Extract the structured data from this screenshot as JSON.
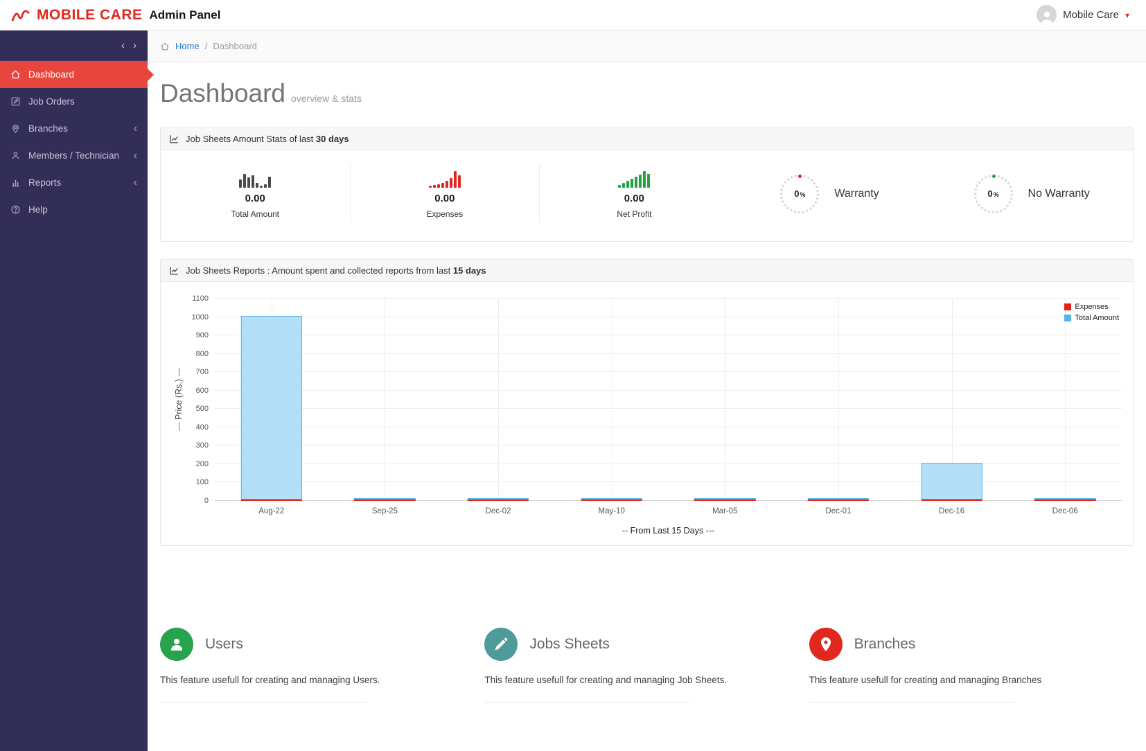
{
  "header": {
    "brand": "MOBILE CARE",
    "brand_suffix": "Admin Panel",
    "user_menu": {
      "name": "Mobile Care",
      "caret": "▾"
    }
  },
  "sidebar": {
    "collapse_left": "‹",
    "collapse_right": "›",
    "submenu_chevron": "‹",
    "items": [
      {
        "label": "Dashboard",
        "icon": "home-icon",
        "active": true,
        "has_submenu": false
      },
      {
        "label": "Job Orders",
        "icon": "edit-icon",
        "active": false,
        "has_submenu": false
      },
      {
        "label": "Branches",
        "icon": "pin-icon",
        "active": false,
        "has_submenu": true
      },
      {
        "label": "Members / Technician",
        "icon": "user-icon",
        "active": false,
        "has_submenu": true
      },
      {
        "label": "Reports",
        "icon": "bar-chart-icon",
        "active": false,
        "has_submenu": true
      },
      {
        "label": "Help",
        "icon": "help-icon",
        "active": false,
        "has_submenu": false
      }
    ]
  },
  "breadcrumb": {
    "home_label": "Home",
    "separator": "/",
    "current": "Dashboard"
  },
  "page_header": {
    "title": "Dashboard",
    "subtitle": "overview & stats"
  },
  "stats_panel": {
    "title_prefix": "Job Sheets Amount Stats of last ",
    "title_bold": "30 days",
    "stats": [
      {
        "value": "0.00",
        "label": "Total Amount",
        "spark_color": "#4a4a4a",
        "spark": [
          12,
          20,
          15,
          18,
          7,
          3,
          5,
          16
        ]
      },
      {
        "value": "0.00",
        "label": "Expenses",
        "spark_color": "#e0281f",
        "spark": [
          3,
          4,
          5,
          7,
          10,
          14,
          24,
          18
        ]
      },
      {
        "value": "0.00",
        "label": "Net Profit",
        "spark_color": "#27a243",
        "spark": [
          4,
          7,
          10,
          13,
          16,
          19,
          24,
          20
        ]
      }
    ],
    "knobs": [
      {
        "value": "0",
        "unit": "%",
        "label": "Warranty",
        "dot_color": "#e0281f"
      },
      {
        "value": "0",
        "unit": "%",
        "label": "No Warranty",
        "dot_color": "#27a243"
      }
    ]
  },
  "report_panel": {
    "title_prefix": "Job Sheets Reports : Amount spent and collected reports from last ",
    "title_bold": "15 days"
  },
  "chart_data": {
    "type": "bar",
    "categories": [
      "Aug-22",
      "Sep-25",
      "Dec-02",
      "May-10",
      "Mar-05",
      "Dec-01",
      "Dec-16",
      "Dec-06"
    ],
    "series": [
      {
        "name": "Expenses",
        "color": "#e8211d",
        "fill": "#e8211d",
        "values": [
          0,
          0,
          0,
          0,
          0,
          0,
          0,
          0
        ]
      },
      {
        "name": "Total Amount",
        "color": "#56b4e6",
        "fill": "#b3dff8",
        "values": [
          1000,
          0,
          0,
          0,
          0,
          0,
          200,
          0
        ]
      }
    ],
    "title": "Job Sheets Reports",
    "xlabel": "-- From Last 15 Days ---",
    "ylabel": "--- Price (Rs.) ---",
    "ylim": [
      0,
      1100
    ],
    "ytick_step": 100,
    "grid": true,
    "legend_position": "top-right"
  },
  "features": [
    {
      "title": "Users",
      "description": "This feature usefull for creating and managing Users.",
      "icon": "user-icon",
      "color": "#28a24c"
    },
    {
      "title": "Jobs Sheets",
      "description": "This feature usefull for creating and managing Job Sheets.",
      "icon": "pencil-icon",
      "color": "#4f9b9b"
    },
    {
      "title": "Branches",
      "description": "This feature usefull for creating and managing Branches",
      "icon": "pin-icon",
      "color": "#e0281f"
    }
  ]
}
